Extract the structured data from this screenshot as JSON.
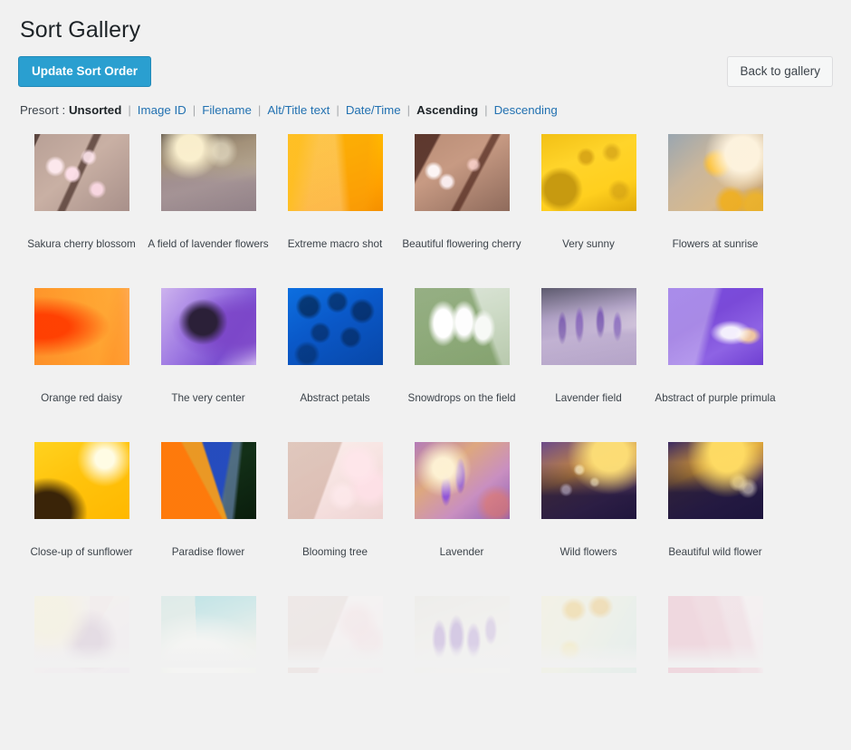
{
  "header": {
    "title": "Sort Gallery",
    "update_button": "Update Sort Order",
    "back_button": "Back to gallery"
  },
  "presort": {
    "label": "Presort :",
    "separator": "|",
    "options": [
      {
        "label": "Unsorted",
        "active": true
      },
      {
        "label": "Image ID",
        "active": false
      },
      {
        "label": "Filename",
        "active": false
      },
      {
        "label": "Alt/Title text",
        "active": false
      },
      {
        "label": "Date/Time",
        "active": false
      },
      {
        "label": "Ascending",
        "active": true
      },
      {
        "label": "Descending",
        "active": false
      }
    ]
  },
  "gallery": {
    "columns": 6,
    "items": [
      {
        "caption": "Sakura cherry blossom",
        "thumb": "thumb-sakura-cherry-blossom",
        "faded": false
      },
      {
        "caption": "A field of lavender flowers",
        "thumb": "thumb-field-of-lavender",
        "faded": false
      },
      {
        "caption": "Extreme macro shot",
        "thumb": "thumb-extreme-macro-shot",
        "faded": false
      },
      {
        "caption": "Beautiful flowering cherry",
        "thumb": "thumb-beautiful-flowering-cherry",
        "faded": false
      },
      {
        "caption": "Very sunny",
        "thumb": "thumb-very-sunny",
        "faded": false
      },
      {
        "caption": "Flowers at sunrise",
        "thumb": "thumb-flowers-at-sunrise",
        "faded": false
      },
      {
        "caption": "Orange red daisy",
        "thumb": "thumb-orange-red-daisy",
        "faded": false
      },
      {
        "caption": "The very center",
        "thumb": "thumb-the-very-center",
        "faded": false
      },
      {
        "caption": "Abstract petals",
        "thumb": "thumb-abstract-petals",
        "faded": false
      },
      {
        "caption": "Snowdrops on the field",
        "thumb": "thumb-snowdrops-on-the-field",
        "faded": false
      },
      {
        "caption": "Lavender field",
        "thumb": "thumb-lavender-field",
        "faded": false
      },
      {
        "caption": "Abstract of purple primula",
        "thumb": "thumb-abstract-purple-primula",
        "faded": false
      },
      {
        "caption": "Close-up of sunflower",
        "thumb": "thumb-close-up-of-sunflower",
        "faded": false
      },
      {
        "caption": "Paradise flower",
        "thumb": "thumb-paradise-flower",
        "faded": false
      },
      {
        "caption": "Blooming tree",
        "thumb": "thumb-blooming-tree",
        "faded": false
      },
      {
        "caption": "Lavender",
        "thumb": "thumb-lavender",
        "faded": false
      },
      {
        "caption": "Wild flowers",
        "thumb": "thumb-wild-flowers",
        "faded": false
      },
      {
        "caption": "Beautiful wild flower",
        "thumb": "thumb-beautiful-wild-flower",
        "faded": false
      },
      {
        "caption": "",
        "thumb": "thumb-sunflower-pastel",
        "faded": true
      },
      {
        "caption": "",
        "thumb": "thumb-dandelion-teal",
        "faded": true
      },
      {
        "caption": "",
        "thumb": "thumb-blossom-pale",
        "faded": true
      },
      {
        "caption": "",
        "thumb": "thumb-crocus-pale",
        "faded": true
      },
      {
        "caption": "",
        "thumb": "thumb-poppies-pale",
        "faded": true
      },
      {
        "caption": "",
        "thumb": "thumb-pink-petals-pale",
        "faded": true
      }
    ]
  },
  "colors": {
    "background": "#f1f1f1",
    "accent": "#2a9fd0",
    "link": "#2271b1",
    "text": "#3c434a",
    "heading": "#1d2327"
  }
}
